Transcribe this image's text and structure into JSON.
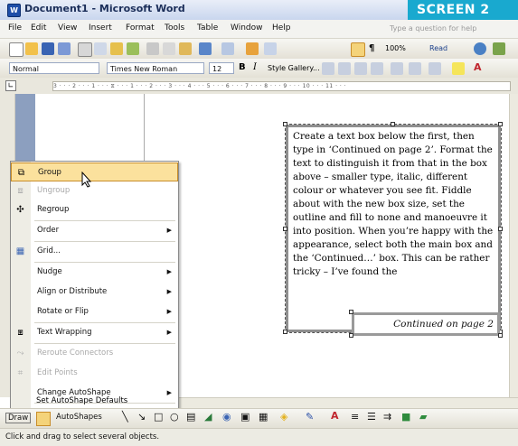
{
  "window": {
    "title": "Document1 - Microsoft Word",
    "app_icon": "W",
    "badge": "SCREEN 2"
  },
  "menubar": {
    "items": [
      "File",
      "Edit",
      "View",
      "Insert",
      "Format",
      "Tools",
      "Table",
      "Window",
      "Help"
    ],
    "ask_placeholder": "Type a question for help"
  },
  "standard_toolbar": {
    "zoom": "100%",
    "read_label": "Read"
  },
  "formatting_toolbar": {
    "style": "Normal",
    "font": "Times New Roman",
    "size": "12",
    "style_gallery": "Style Gallery..."
  },
  "ruler": {
    "marks": "3 · · · 2 · · · 1 · · · ⧖ · · · 1 · · · 2 · · · 3 · · · 4 · · · 5 · · · 6 · · · 7 · · · 8 · · · 9 · · · 10 · · · 11 · · ·"
  },
  "textbox": {
    "text": "Create a text box below the first, then type in ‘Continued on page 2’. Format the text to distinguish it from that in the box above – smaller type, italic, different colour or whatever you see fit. Fiddle about with the new box size, set the outline and fill to none and manoeuvre it into position. When you’re happy with the appearance, select both the main box and the ‘Continued…’ box. This can be rather tricky – I’ve found the"
  },
  "continued_box": {
    "text": "Continued on page 2"
  },
  "context_menu": {
    "items": [
      {
        "label": "Group",
        "icon": "group-icon",
        "highlighted": true,
        "disabled": false,
        "submenu": false
      },
      {
        "label": "Ungroup",
        "icon": "ungroup-icon",
        "highlighted": false,
        "disabled": true,
        "submenu": false
      },
      {
        "label": "Regroup",
        "icon": "regroup-icon",
        "highlighted": false,
        "disabled": false,
        "submenu": false
      },
      {
        "label": "Order",
        "icon": "",
        "highlighted": false,
        "disabled": false,
        "submenu": true
      },
      {
        "label": "Grid...",
        "icon": "grid-icon",
        "highlighted": false,
        "disabled": false,
        "submenu": false
      },
      {
        "label": "Nudge",
        "icon": "",
        "highlighted": false,
        "disabled": false,
        "submenu": true
      },
      {
        "label": "Align or Distribute",
        "icon": "",
        "highlighted": false,
        "disabled": false,
        "submenu": true
      },
      {
        "label": "Rotate or Flip",
        "icon": "",
        "highlighted": false,
        "disabled": false,
        "submenu": true
      },
      {
        "label": "Text Wrapping",
        "icon": "text-wrapping-icon",
        "highlighted": false,
        "disabled": false,
        "submenu": true
      },
      {
        "label": "Reroute Connectors",
        "icon": "reroute-icon",
        "highlighted": false,
        "disabled": true,
        "submenu": false
      },
      {
        "label": "Edit Points",
        "icon": "edit-points-icon",
        "highlighted": false,
        "disabled": true,
        "submenu": false
      },
      {
        "label": "Change AutoShape",
        "icon": "",
        "highlighted": false,
        "disabled": false,
        "submenu": true
      },
      {
        "label": "Set AutoShape Defaults",
        "icon": "",
        "highlighted": false,
        "disabled": false,
        "submenu": false
      }
    ]
  },
  "drawing_toolbar": {
    "draw_label": "Draw",
    "autoshapes_label": "AutoShapes"
  },
  "status": {
    "text": "Click and drag to select several objects."
  },
  "colors": {
    "accent_badge": "#19a9cf",
    "menu_highlight": "#fbe19d",
    "menu_highlight_border": "#c88d2a"
  }
}
